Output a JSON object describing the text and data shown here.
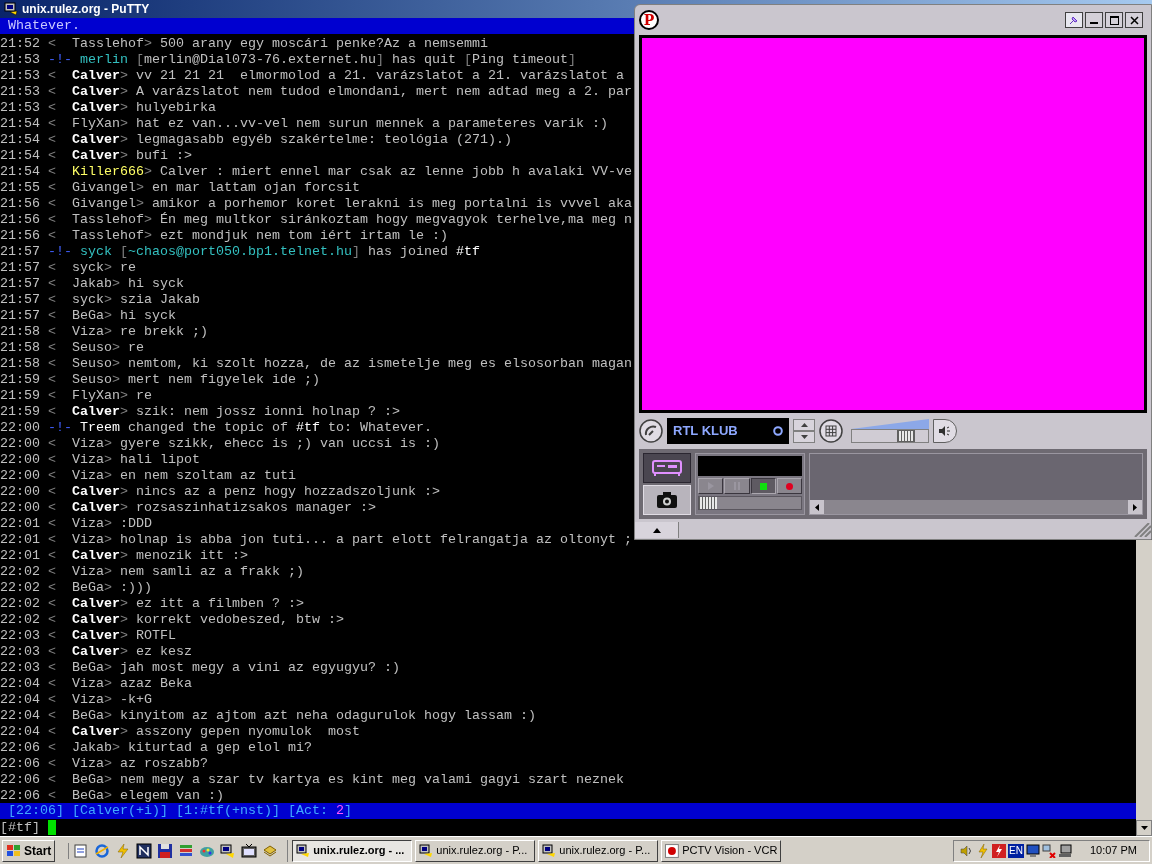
{
  "window": {
    "title": "unix.rulez.org - PuTTY"
  },
  "terminal": {
    "topic": "Whatever.",
    "lines": [
      {
        "time": "21:52",
        "kind": "msg",
        "mark": "<",
        "nick": "Tasslehof",
        "own": false,
        "highlight": false,
        "sep": ">",
        "text": "500 arany egy moscári penke?Az a nemsemmi"
      },
      {
        "time": "21:53",
        "kind": "event",
        "parts": [
          {
            "kind": "mark",
            "text": "-!-"
          },
          {
            "kind": "nick",
            "text": "merlin"
          },
          {
            "kind": "bracket",
            "text": "["
          },
          {
            "kind": "plain",
            "text": "merlin@Dial073-76.externet.hu"
          },
          {
            "kind": "bracket",
            "text": "]"
          },
          {
            "kind": "plain",
            "text": "has quit"
          },
          {
            "kind": "bracket",
            "text": "["
          },
          {
            "kind": "plain",
            "text": "Ping timeout"
          },
          {
            "kind": "bracket",
            "text": "]"
          }
        ]
      },
      {
        "time": "21:53",
        "kind": "msg",
        "mark": "<",
        "nick": "Calver",
        "own": true,
        "highlight": false,
        "sep": ">",
        "text": "vv 21 21 21  elmormolod a 21. varázslatot a 21. varázslatot a"
      },
      {
        "time": "21:53",
        "kind": "msg",
        "mark": "<",
        "nick": "Calver",
        "own": true,
        "highlight": false,
        "sep": ">",
        "text": "A varázslatot nem tudod elmondani, mert nem adtad meg a 2. par"
      },
      {
        "time": "21:53",
        "kind": "msg",
        "mark": "<",
        "nick": "Calver",
        "own": true,
        "highlight": false,
        "sep": ">",
        "text": "hulyebirka"
      },
      {
        "time": "21:54",
        "kind": "msg",
        "mark": "<",
        "nick": "FlyXan",
        "own": false,
        "highlight": false,
        "sep": ">",
        "text": "hat ez van...vv-vel nem surun mennek a parameteres varik :)"
      },
      {
        "time": "21:54",
        "kind": "msg",
        "mark": "<",
        "nick": "Calver",
        "own": true,
        "highlight": false,
        "sep": ">",
        "text": "legmagasabb egyéb szakértelme: teológia (271).)"
      },
      {
        "time": "21:54",
        "kind": "msg",
        "mark": "<",
        "nick": "Calver",
        "own": true,
        "highlight": false,
        "sep": ">",
        "text": "bufi :>"
      },
      {
        "time": "21:54",
        "kind": "msg",
        "mark": "<",
        "nick": "Killer666",
        "own": false,
        "highlight": true,
        "sep": ">",
        "text": "Calver : miert ennel mar csak az lenne jobb h avalaki VV-ve"
      },
      {
        "time": "21:55",
        "kind": "msg",
        "mark": "<",
        "nick": "Givangel",
        "own": false,
        "highlight": false,
        "sep": ">",
        "text": "en mar lattam ojan forcsit"
      },
      {
        "time": "21:56",
        "kind": "msg",
        "mark": "<",
        "nick": "Givangel",
        "own": false,
        "highlight": false,
        "sep": ">",
        "text": "amikor a porhemor koret lerakni is meg portalni is vvvel aka"
      },
      {
        "time": "21:56",
        "kind": "msg",
        "mark": "<",
        "nick": "Tasslehof",
        "own": false,
        "highlight": false,
        "sep": ">",
        "text": "Én meg multkor siránkoztam hogy megvagyok terhelve,ma meg n"
      },
      {
        "time": "21:56",
        "kind": "msg",
        "mark": "<",
        "nick": "Tasslehof",
        "own": false,
        "highlight": false,
        "sep": ">",
        "text": "ezt mondjuk nem tom iért irtam le :)"
      },
      {
        "time": "21:57",
        "kind": "event",
        "parts": [
          {
            "kind": "mark",
            "text": "-!-"
          },
          {
            "kind": "nick",
            "text": "syck"
          },
          {
            "kind": "bracket",
            "text": "["
          },
          {
            "kind": "host",
            "text": "~chaos@port050.bp1.telnet.hu"
          },
          {
            "kind": "bracket",
            "text": "]"
          },
          {
            "kind": "plain",
            "text": "has joined"
          },
          {
            "kind": "channel",
            "text": "#tf"
          }
        ]
      },
      {
        "time": "21:57",
        "kind": "msg",
        "mark": "<",
        "nick": "syck",
        "own": false,
        "highlight": false,
        "sep": ">",
        "text": "re"
      },
      {
        "time": "21:57",
        "kind": "msg",
        "mark": "<",
        "nick": "Jakab",
        "own": false,
        "highlight": false,
        "sep": ">",
        "text": "hi syck"
      },
      {
        "time": "21:57",
        "kind": "msg",
        "mark": "<",
        "nick": "syck",
        "own": false,
        "highlight": false,
        "sep": ">",
        "text": "szia Jakab"
      },
      {
        "time": "21:57",
        "kind": "msg",
        "mark": "<",
        "nick": "BeGa",
        "own": false,
        "highlight": false,
        "sep": ">",
        "text": "hi syck"
      },
      {
        "time": "21:58",
        "kind": "msg",
        "mark": "<",
        "nick": "Viza",
        "own": false,
        "highlight": false,
        "sep": ">",
        "text": "re brekk ;)"
      },
      {
        "time": "21:58",
        "kind": "msg",
        "mark": "<",
        "nick": "Seuso",
        "own": false,
        "highlight": false,
        "sep": ">",
        "text": "re"
      },
      {
        "time": "21:58",
        "kind": "msg",
        "mark": "<",
        "nick": "Seuso",
        "own": false,
        "highlight": false,
        "sep": ">",
        "text": "nemtom, ki szolt hozza, de az ismetelje meg es elsosorban magan"
      },
      {
        "time": "21:59",
        "kind": "msg",
        "mark": "<",
        "nick": "Seuso",
        "own": false,
        "highlight": false,
        "sep": ">",
        "text": "mert nem figyelek ide ;)"
      },
      {
        "time": "21:59",
        "kind": "msg",
        "mark": "<",
        "nick": "FlyXan",
        "own": false,
        "highlight": false,
        "sep": ">",
        "text": "re"
      },
      {
        "time": "21:59",
        "kind": "msg",
        "mark": "<",
        "nick": "Calver",
        "own": true,
        "highlight": false,
        "sep": ">",
        "text": "szik: nem jossz ionni holnap ? :>"
      },
      {
        "time": "22:00",
        "kind": "event",
        "parts": [
          {
            "kind": "mark",
            "text": "-!-"
          },
          {
            "kind": "actor",
            "text": "Treem"
          },
          {
            "kind": "plain",
            "text": "changed the topic of"
          },
          {
            "kind": "channel",
            "text": "#tf"
          },
          {
            "kind": "plain",
            "text": "to: Whatever."
          }
        ]
      },
      {
        "time": "22:00",
        "kind": "msg",
        "mark": "<",
        "nick": "Viza",
        "own": false,
        "highlight": false,
        "sep": ">",
        "text": "gyere szikk, ehecc is ;) van uccsi is :)"
      },
      {
        "time": "22:00",
        "kind": "msg",
        "mark": "<",
        "nick": "Viza",
        "own": false,
        "highlight": false,
        "sep": ">",
        "text": "hali lipot"
      },
      {
        "time": "22:00",
        "kind": "msg",
        "mark": "<",
        "nick": "Viza",
        "own": false,
        "highlight": false,
        "sep": ">",
        "text": "en nem szoltam az tuti"
      },
      {
        "time": "22:00",
        "kind": "msg",
        "mark": "<",
        "nick": "Calver",
        "own": true,
        "highlight": false,
        "sep": ">",
        "text": "nincs az a penz hogy hozzadszoljunk :>"
      },
      {
        "time": "22:00",
        "kind": "msg",
        "mark": "<",
        "nick": "Calver",
        "own": true,
        "highlight": false,
        "sep": ">",
        "text": "rozsaszinhatizsakos manager :>"
      },
      {
        "time": "22:01",
        "kind": "msg",
        "mark": "<",
        "nick": "Viza",
        "own": false,
        "highlight": false,
        "sep": ">",
        "text": ":DDD"
      },
      {
        "time": "22:01",
        "kind": "msg",
        "mark": "<",
        "nick": "Viza",
        "own": false,
        "highlight": false,
        "sep": ">",
        "text": "holnap is abba jon tuti... a part elott felrangatja az oltonyt ;"
      },
      {
        "time": "22:01",
        "kind": "msg",
        "mark": "<",
        "nick": "Calver",
        "own": true,
        "highlight": false,
        "sep": ">",
        "text": "menozik itt :>"
      },
      {
        "time": "22:02",
        "kind": "msg",
        "mark": "<",
        "nick": "Viza",
        "own": false,
        "highlight": false,
        "sep": ">",
        "text": "nem samli az a frakk ;)"
      },
      {
        "time": "22:02",
        "kind": "msg",
        "mark": "<",
        "nick": "BeGa",
        "own": false,
        "highlight": false,
        "sep": ">",
        "text": ":)))"
      },
      {
        "time": "22:02",
        "kind": "msg",
        "mark": "<",
        "nick": "Calver",
        "own": true,
        "highlight": false,
        "sep": ">",
        "text": "ez itt a filmben ? :>"
      },
      {
        "time": "22:02",
        "kind": "msg",
        "mark": "<",
        "nick": "Calver",
        "own": true,
        "highlight": false,
        "sep": ">",
        "text": "korrekt vedobeszed, btw :>"
      },
      {
        "time": "22:03",
        "kind": "msg",
        "mark": "<",
        "nick": "Calver",
        "own": true,
        "highlight": false,
        "sep": ">",
        "text": "ROTFL"
      },
      {
        "time": "22:03",
        "kind": "msg",
        "mark": "<",
        "nick": "Calver",
        "own": true,
        "highlight": false,
        "sep": ">",
        "text": "ez kesz"
      },
      {
        "time": "22:03",
        "kind": "msg",
        "mark": "<",
        "nick": "BeGa",
        "own": false,
        "highlight": false,
        "sep": ">",
        "text": "jah most megy a vini az egyugyu? :)"
      },
      {
        "time": "22:04",
        "kind": "msg",
        "mark": "<",
        "nick": "Viza",
        "own": false,
        "highlight": false,
        "sep": ">",
        "text": "azaz Beka"
      },
      {
        "time": "22:04",
        "kind": "msg",
        "mark": "<",
        "nick": "Viza",
        "own": false,
        "highlight": false,
        "sep": ">",
        "text": "-k+G"
      },
      {
        "time": "22:04",
        "kind": "msg",
        "mark": "<",
        "nick": "BeGa",
        "own": false,
        "highlight": false,
        "sep": ">",
        "text": "kinyitom az ajtom azt neha odagurulok hogy lassam :)"
      },
      {
        "time": "22:04",
        "kind": "msg",
        "mark": "<",
        "nick": "Calver",
        "own": true,
        "highlight": false,
        "sep": ">",
        "text": "asszony gepen nyomulok  most"
      },
      {
        "time": "22:06",
        "kind": "msg",
        "mark": "<",
        "nick": "Jakab",
        "own": false,
        "highlight": false,
        "sep": ">",
        "text": "kiturtad a gep elol mi?"
      },
      {
        "time": "22:06",
        "kind": "msg",
        "mark": "<",
        "nick": "Viza",
        "own": false,
        "highlight": false,
        "sep": ">",
        "text": "az roszabb?"
      },
      {
        "time": "22:06",
        "kind": "msg",
        "mark": "<",
        "nick": "BeGa",
        "own": false,
        "highlight": false,
        "sep": ">",
        "text": "nem megy a szar tv kartya es kint meg valami gagyi szart neznek"
      },
      {
        "time": "22:06",
        "kind": "msg",
        "mark": "<",
        "nick": "BeGa",
        "own": false,
        "highlight": false,
        "sep": ">",
        "text": "elegem van :)"
      }
    ],
    "status_bar": [
      {
        "kind": "item",
        "text": "[22:06]"
      },
      {
        "kind": "item",
        "text": "[Calver(+i)]"
      },
      {
        "kind": "item",
        "text": "[1:#tf(+nst)]"
      },
      {
        "kind": "item",
        "text": "[Act:"
      },
      {
        "kind": "count",
        "text": "2"
      },
      {
        "kind": "close",
        "text": "]"
      }
    ],
    "input": {
      "prompt": "[#tf]"
    }
  },
  "tv_window": {
    "logo": "P",
    "channel": "RTL KLUB",
    "volume": {
      "level": 0.78
    },
    "side_tabs": [
      {
        "kind": "vcr",
        "selected": true
      },
      {
        "kind": "camera",
        "selected": false
      }
    ],
    "transport": [
      {
        "kind": "play",
        "pressed": false
      },
      {
        "kind": "pause",
        "pressed": false
      },
      {
        "kind": "stop",
        "pressed": true
      },
      {
        "kind": "record",
        "pressed": false
      }
    ],
    "position": {
      "level": 0
    }
  },
  "taskbar": {
    "start": "Start",
    "tasks": [
      {
        "label": "unix.rulez.org - ...",
        "kind": "terminal",
        "selected": true
      },
      {
        "label": "unix.rulez.org - P...",
        "kind": "terminal",
        "selected": false
      },
      {
        "label": "unix.rulez.org - P...",
        "kind": "terminal",
        "selected": false
      },
      {
        "label": "PCTV Vision - VCR",
        "kind": "tv",
        "selected": false
      }
    ],
    "language": "EN",
    "clock": "10:07 PM"
  }
}
